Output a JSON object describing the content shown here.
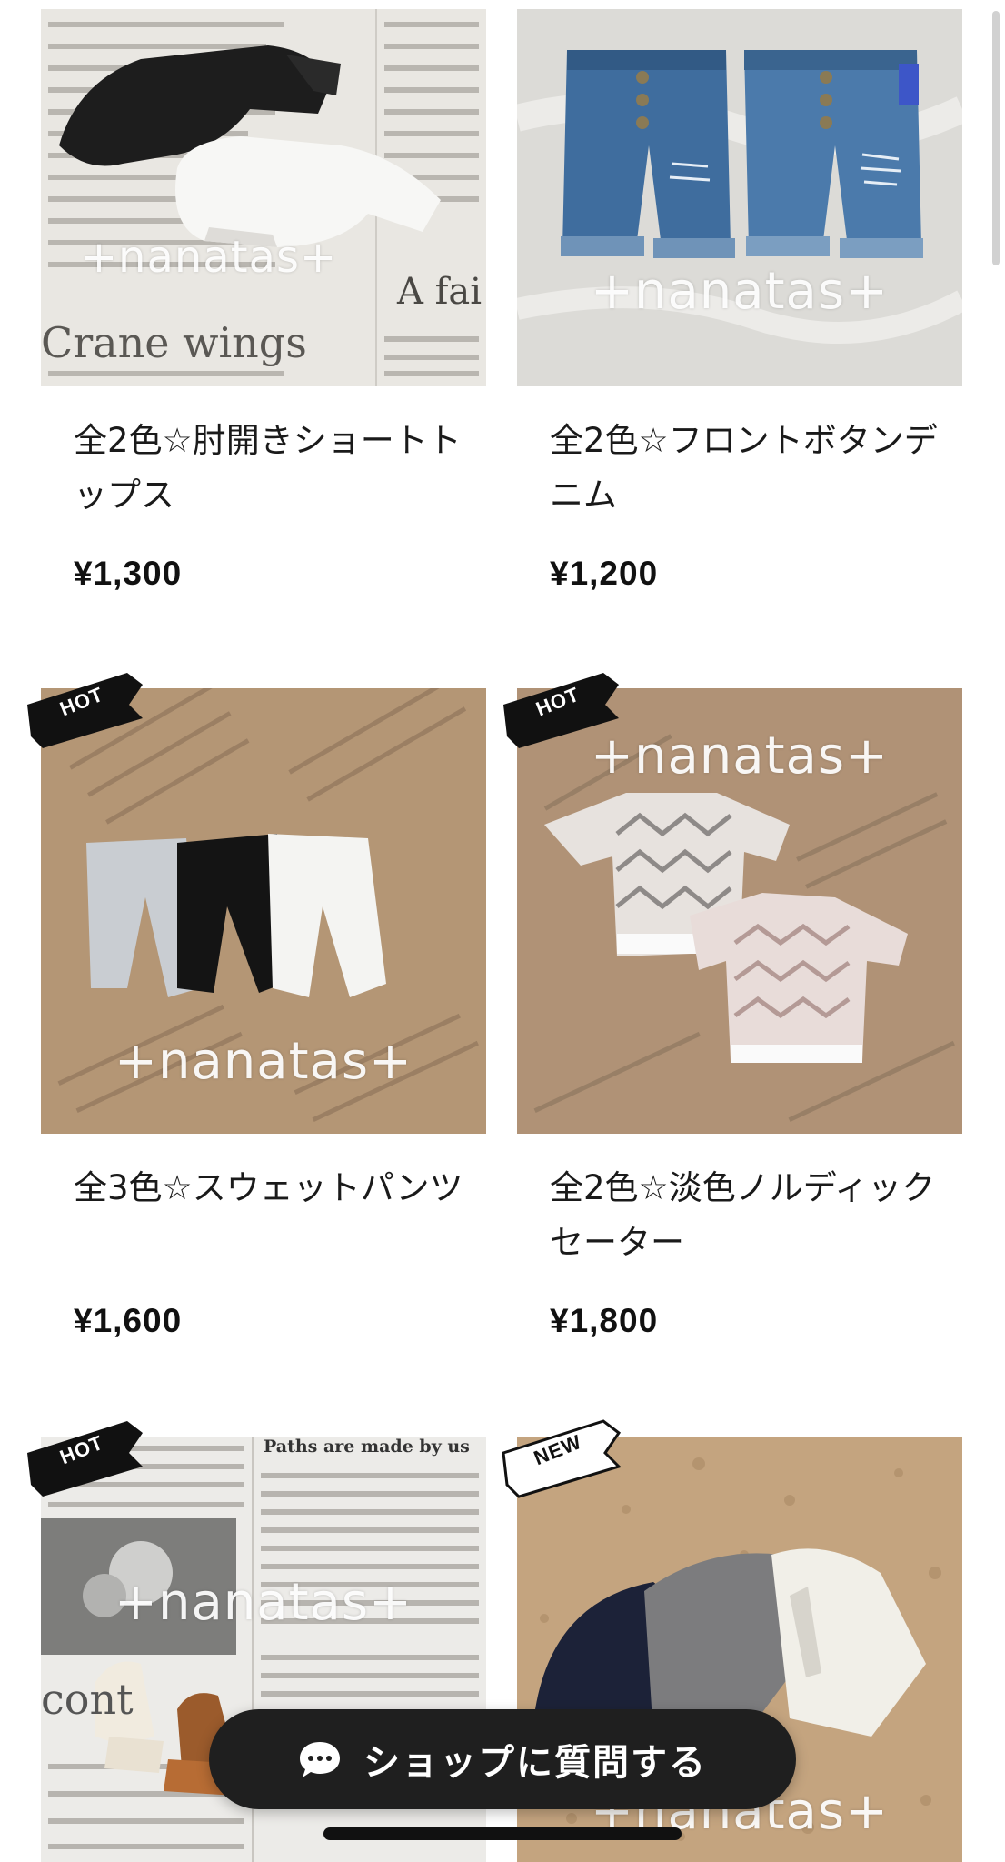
{
  "products": [
    {
      "title": "全2色☆肘開きショートトップス",
      "price": "¥1,300",
      "watermark": "+nanatas+",
      "badge": "",
      "image": "black and white cropped tops on newspaper"
    },
    {
      "title": "全2色☆フロントボタンデニム",
      "price": "¥1,200",
      "watermark": "+nanatas+",
      "badge": "",
      "image": "denim shorts on white plaster"
    },
    {
      "title": "全3色☆スウェットパンツ",
      "price": "¥1,600",
      "watermark": "+nanatas+",
      "badge": "HOT",
      "image": "grey black white sweatpants"
    },
    {
      "title": "全2色☆淡色ノルディックセーター",
      "price": "¥1,800",
      "watermark": "+nanatas+",
      "badge": "HOT",
      "image": "nordic pattern sweaters"
    },
    {
      "title": "",
      "price": "",
      "watermark": "+nanatas+",
      "badge": "HOT",
      "image": "doll boots on newspaper"
    },
    {
      "title": "",
      "price": "",
      "watermark": "+nanatas+",
      "badge": "NEW",
      "image": "navy grey white cardigans on cork"
    }
  ],
  "photo_text": {
    "p1_headline": "Crane wings",
    "p1_side": "A fai",
    "p5_headline": "Paths are made by us",
    "p5_side": "cont"
  },
  "fab": {
    "label": "ショップに質問する",
    "icon": "chat-bubble-icon"
  },
  "colors": {
    "badge_hot": "#111111",
    "badge_new": "#ffffff",
    "fab_bg": "#1f1f1f"
  }
}
